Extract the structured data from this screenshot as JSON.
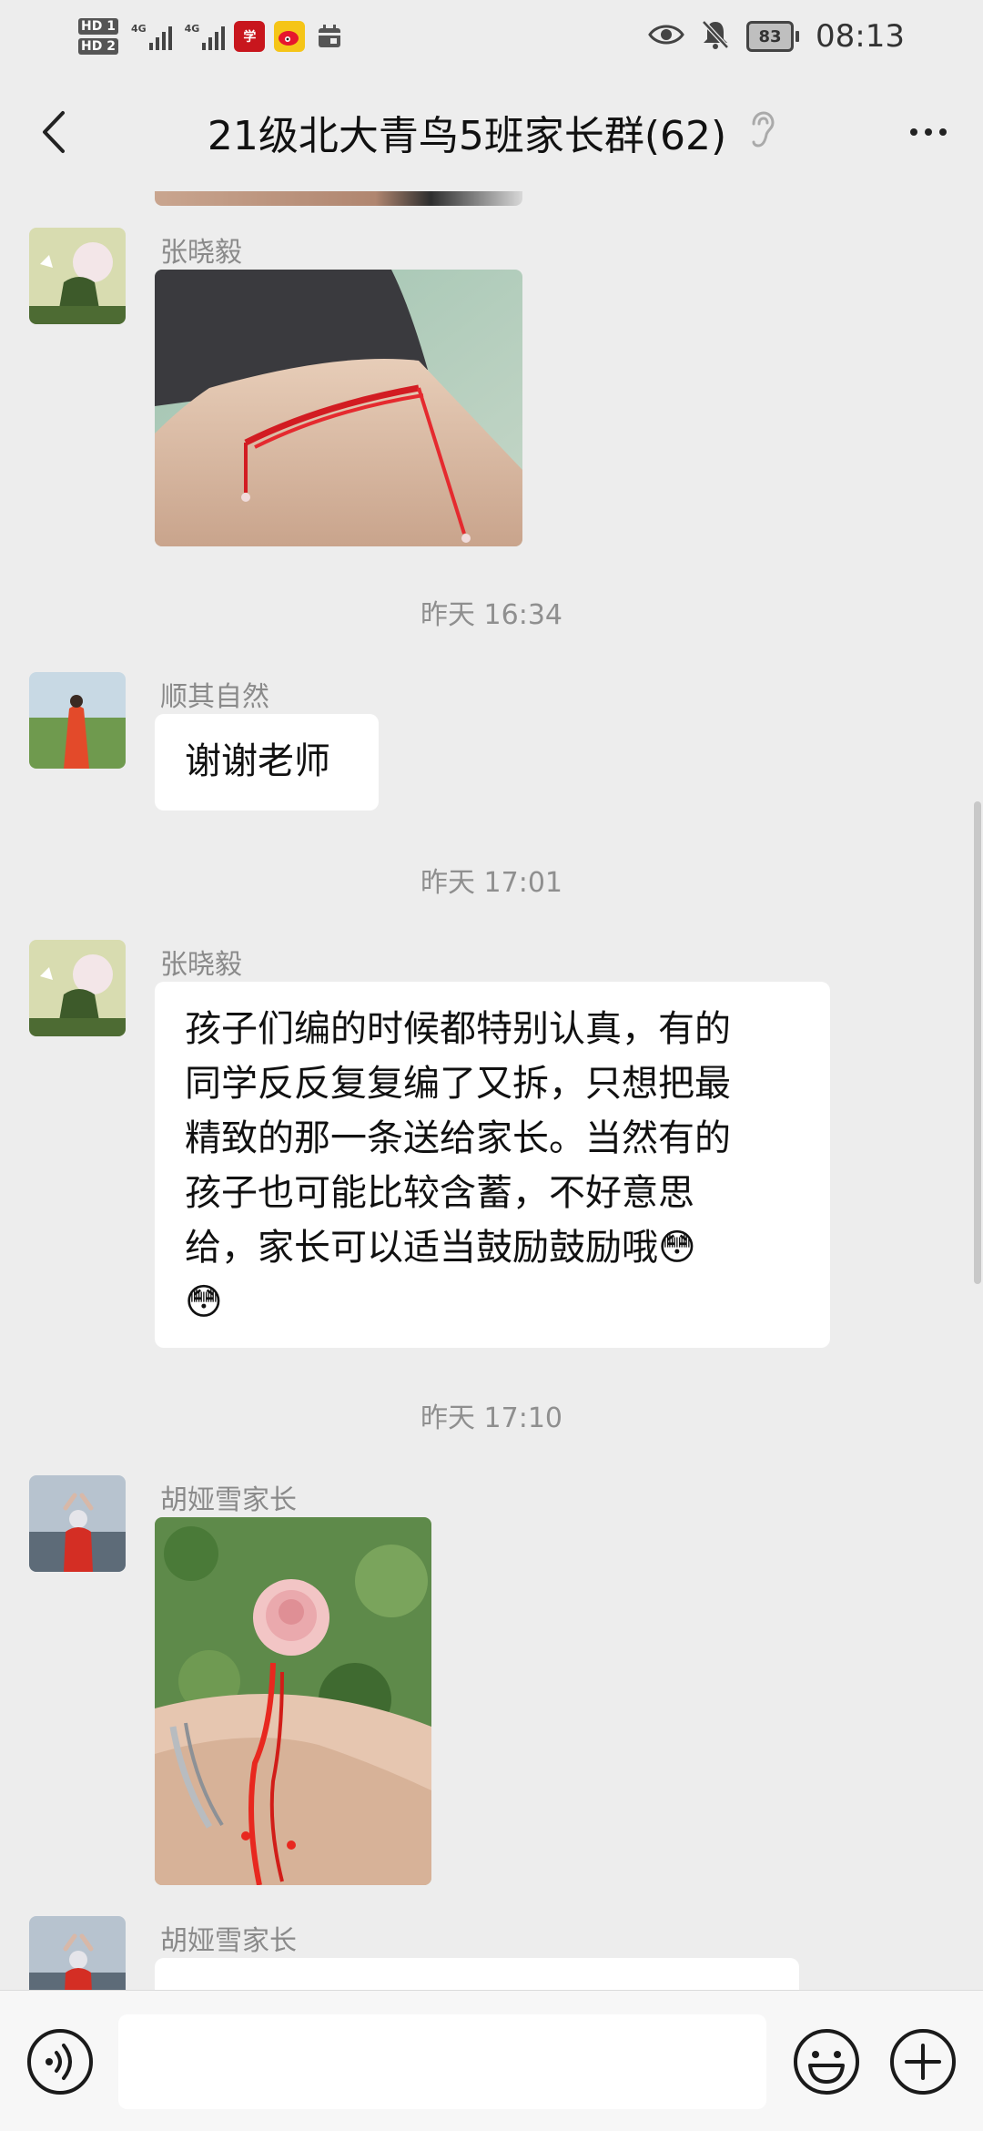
{
  "status_bar": {
    "hd_badges": [
      "HD 1",
      "HD 2"
    ],
    "network_labels": [
      "4G",
      "4G"
    ],
    "app_icons": [
      "xuexi-app-icon",
      "weibo-icon",
      "calendar-icon"
    ],
    "battery_level": "83",
    "time": "08:13"
  },
  "header": {
    "title": "21级北大青鸟5班家长群(62)",
    "back_icon": "chevron-left-icon",
    "ear_icon": "ear-icon",
    "more_icon": "more-dots-icon"
  },
  "chat": {
    "messages": [
      {
        "type": "image",
        "sender": "张晓毅",
        "image_alt": "red braided bracelet on wrist"
      },
      {
        "type": "timestamp",
        "text": "昨天 16:34"
      },
      {
        "type": "text",
        "sender": "顺其自然",
        "text": "谢谢老师"
      },
      {
        "type": "timestamp",
        "text": "昨天 17:01"
      },
      {
        "type": "text",
        "sender": "张晓毅",
        "lines": [
          "孩子们编的时候都特别认真，有的",
          "同学反反复复编了又拆，只想把最",
          "精致的那一条送给家长。当然有的",
          "孩子也可能比较含蓄，不好意思",
          "给，家长可以适当鼓励鼓励哦😳",
          "😳"
        ]
      },
      {
        "type": "timestamp",
        "text": "昨天 17:10"
      },
      {
        "type": "image",
        "sender": "胡娅雪家长",
        "image_alt": "red bracelet with pink rose"
      },
      {
        "type": "text",
        "sender": "胡娅雪家长",
        "text": ""
      }
    ]
  },
  "input_bar": {
    "voice_icon": "voice-icon",
    "input_value": "",
    "emoji_icon": "emoji-icon",
    "plus_icon": "plus-icon"
  },
  "colors": {
    "background": "#EDEDED",
    "bubble": "#FFFFFF",
    "timestamp_text": "#8F8F8F",
    "sender_text": "#8A8A8A"
  }
}
